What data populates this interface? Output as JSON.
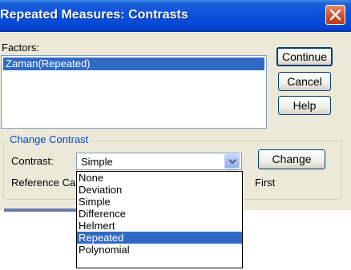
{
  "window": {
    "title": "Repeated Measures: Contrasts"
  },
  "factors": {
    "label": "Factors:",
    "items": [
      "Zaman(Repeated)"
    ]
  },
  "buttons": {
    "continue": "Continue",
    "cancel": "Cancel",
    "help": "Help",
    "change": "Change"
  },
  "change_contrast": {
    "group_title": "Change Contrast",
    "contrast_label": "Contrast:",
    "contrast_value": "Simple",
    "reference_label": "Reference Ca",
    "reference_first": "First"
  },
  "dropdown": {
    "options": [
      "None",
      "Deviation",
      "Simple",
      "Difference",
      "Helmert",
      "Repeated",
      "Polynomial"
    ],
    "highlighted": "Repeated"
  },
  "colors": {
    "title_bar": "#0a52df",
    "selection": "#316ac5",
    "group_title": "#0046d5",
    "dialog_bg": "#ece9d8"
  }
}
